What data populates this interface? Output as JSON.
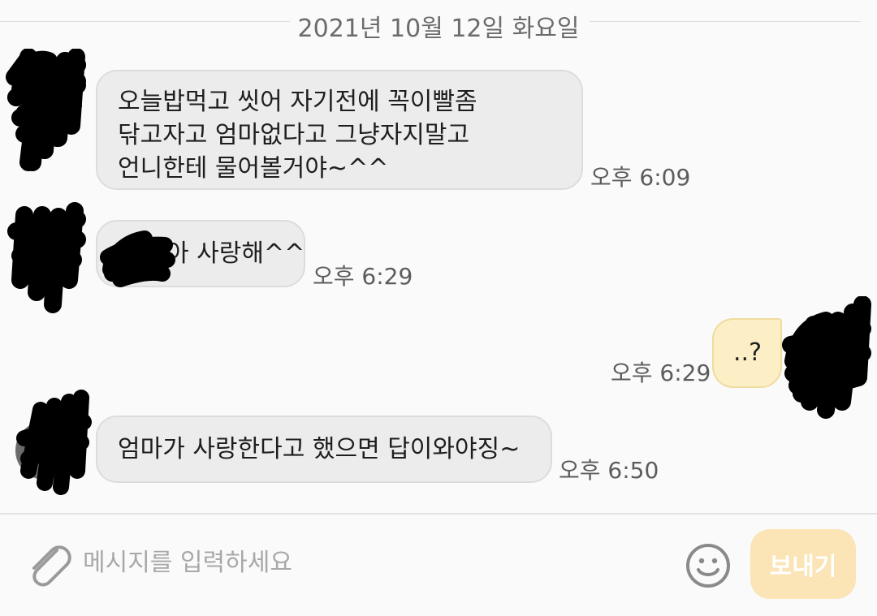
{
  "date_separator": "2021년 10월 12일 화요일",
  "messages": [
    {
      "sender": "other",
      "lines": [
        "오늘밥먹고  씻어 자기전에 꼭이빨좀",
        "닦고자고 엄마없다고 그냥자지말고",
        "언니한테 물어볼거야~^^"
      ],
      "time": "오후 6:09"
    },
    {
      "sender": "other",
      "lines": [
        "아 사랑해^^"
      ],
      "time": "오후 6:29"
    },
    {
      "sender": "me",
      "lines": [
        "..?"
      ],
      "time": "오후 6:29"
    },
    {
      "sender": "other",
      "lines": [
        "엄마가 사랑한다고 했으면 답이와야징~"
      ],
      "time": "오후 6:50"
    }
  ],
  "composer": {
    "placeholder": "메시지를 입력하세요",
    "value": "",
    "send_label": "보내기",
    "attach_icon": "paperclip-icon",
    "emoji_icon": "smiley-icon"
  },
  "colors": {
    "background": "#fafafa",
    "other_bubble": "#ececec",
    "my_bubble": "#fcefc6",
    "send_button": "#fbe4b5",
    "timestamp": "#5c5c5c"
  }
}
